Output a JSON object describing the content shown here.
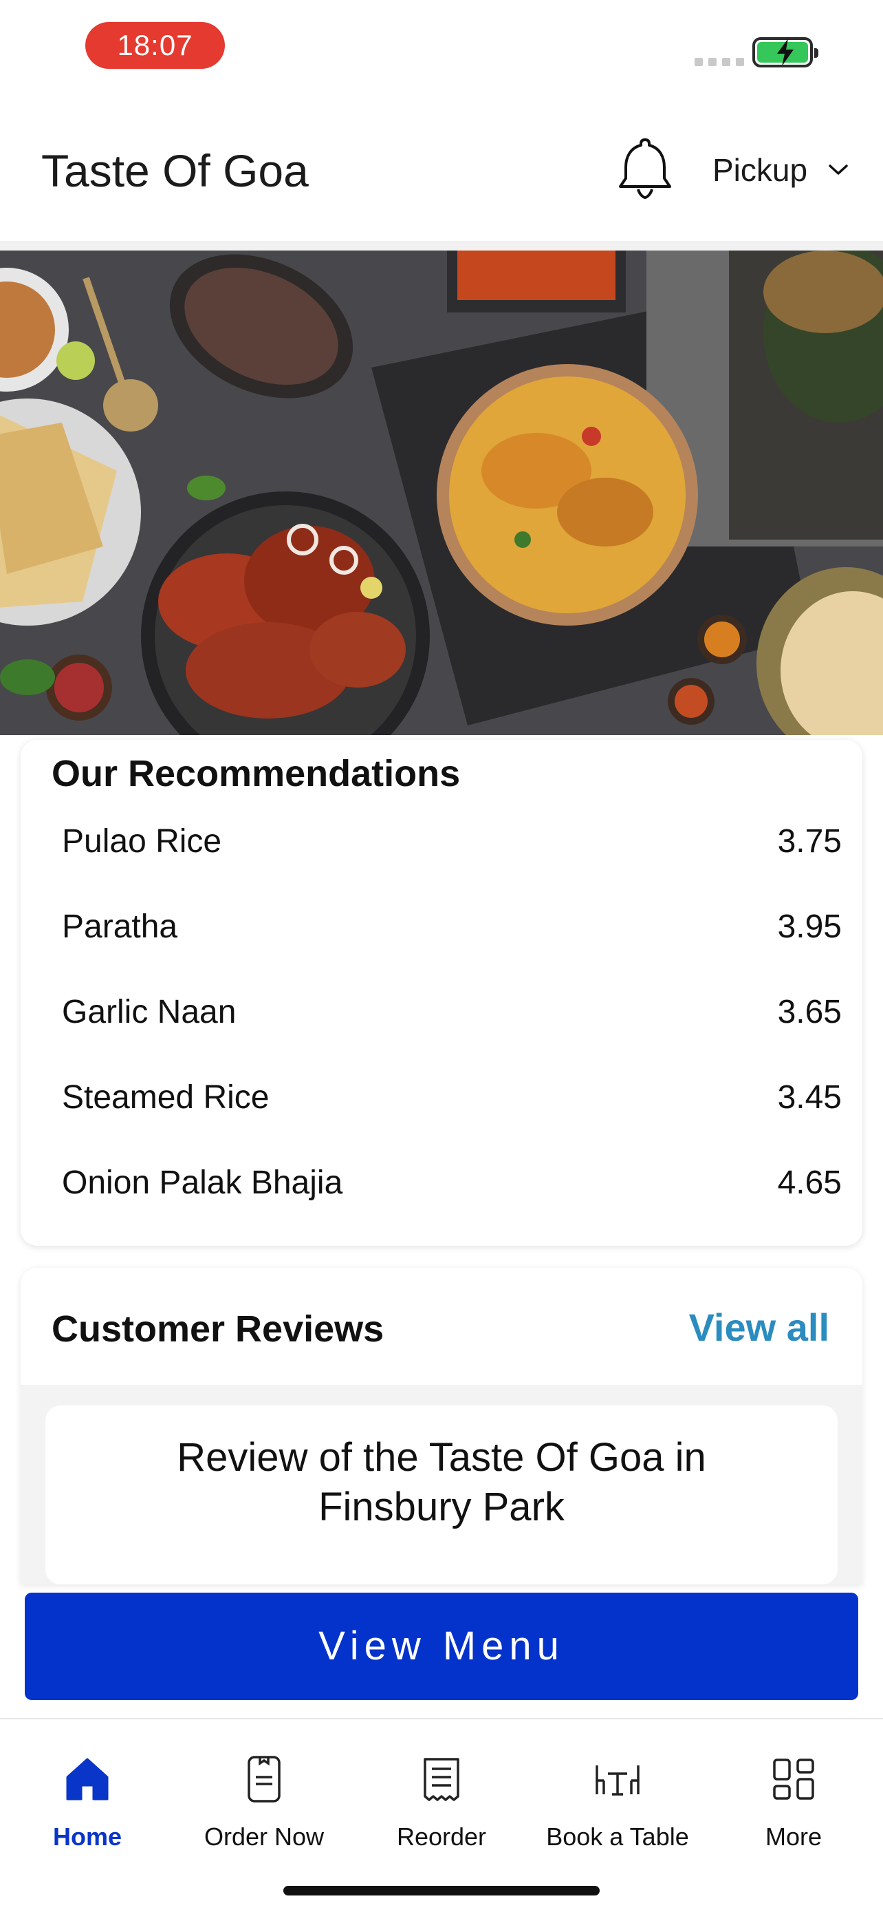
{
  "status_bar": {
    "time": "18:07"
  },
  "header": {
    "title": "Taste Of Goa",
    "mode": "Pickup"
  },
  "recommendations": {
    "title": "Our Recommendations",
    "items": [
      {
        "name": "Pulao Rice",
        "price": "3.75"
      },
      {
        "name": "Paratha",
        "price": "3.95"
      },
      {
        "name": "Garlic Naan",
        "price": "3.65"
      },
      {
        "name": "Steamed Rice",
        "price": "3.45"
      },
      {
        "name": "Onion Palak Bhajia",
        "price": "4.65"
      }
    ]
  },
  "reviews": {
    "title": "Customer Reviews",
    "view_all": "View all",
    "first_review_title": "Review of the Taste Of Goa in Finsbury Park"
  },
  "cta": {
    "label": "View Menu"
  },
  "tabs": [
    {
      "label": "Home",
      "icon": "home-icon",
      "active": true
    },
    {
      "label": "Order Now",
      "icon": "order-phone-icon",
      "active": false
    },
    {
      "label": "Reorder",
      "icon": "receipt-icon",
      "active": false
    },
    {
      "label": "Book a Table",
      "icon": "table-icon",
      "active": false
    },
    {
      "label": "More",
      "icon": "grid-icon",
      "active": false
    }
  ],
  "colors": {
    "accent": "#0433cc",
    "link": "#2b8cbf",
    "time_pill": "#e53a30",
    "battery": "#35c759"
  }
}
